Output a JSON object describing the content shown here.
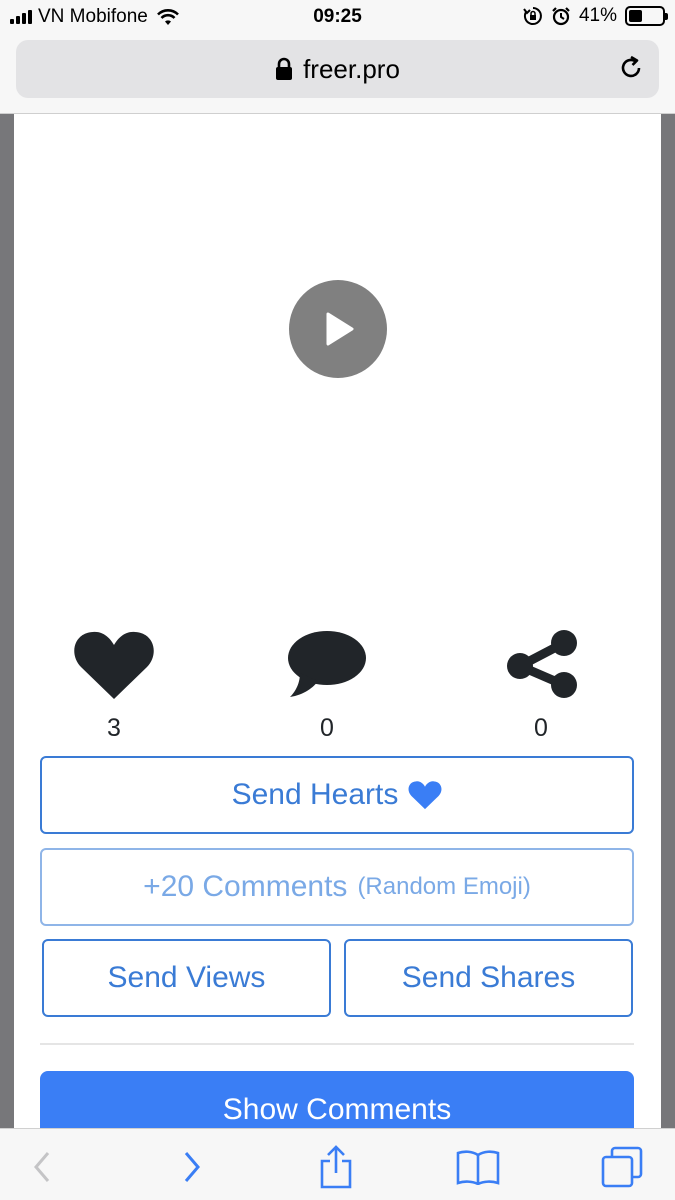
{
  "status_bar": {
    "carrier": "VN Mobifone",
    "time": "09:25",
    "battery": "41%",
    "battery_level": 0.41
  },
  "browser": {
    "url": "freer.pro"
  },
  "video": {
    "play_icon": "play-icon"
  },
  "stats": {
    "hearts": "3",
    "comments": "0",
    "shares": "0"
  },
  "actions": {
    "send_hearts": "Send Hearts",
    "comments_main": "+20 Comments",
    "comments_sub": "(Random Emoji)",
    "send_views": "Send Views",
    "send_shares": "Send Shares",
    "show_comments": "Show Comments"
  },
  "colors": {
    "accent": "#3a7bd5",
    "primary": "#3a7ef5",
    "heart_blue": "#3a7ef5"
  }
}
